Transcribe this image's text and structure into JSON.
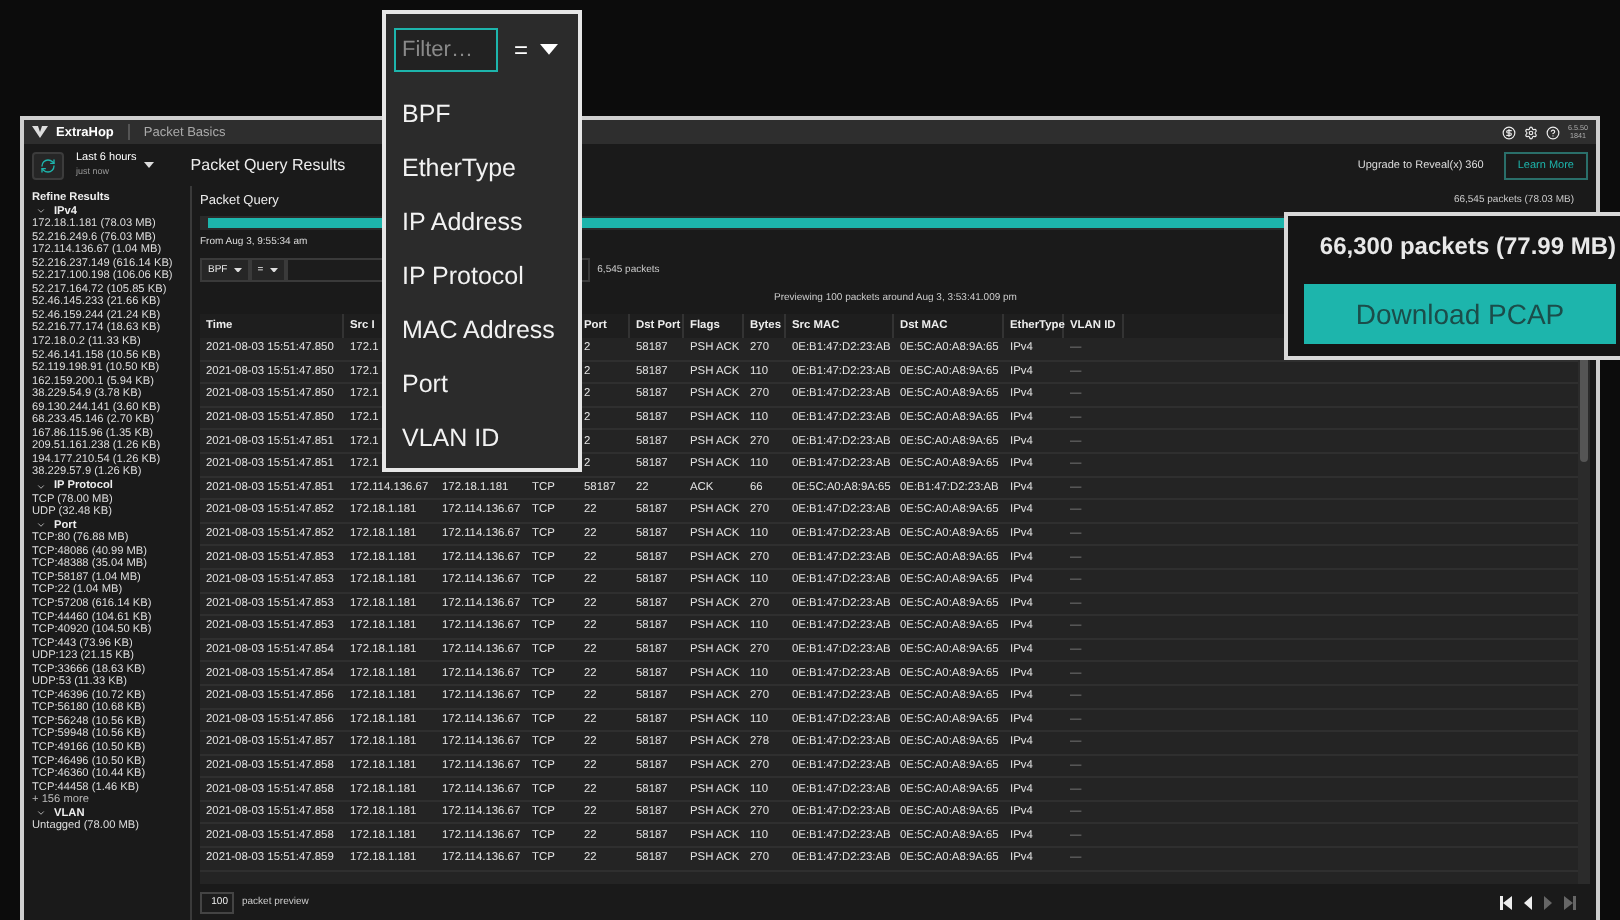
{
  "app": {
    "logo": "ExtraHop",
    "page": "Packet Basics",
    "version": [
      "6.5.50",
      "1841"
    ]
  },
  "toolbar": {
    "time_range": "Last 6 hours",
    "updated": "just now",
    "title": "Packet Query Results",
    "upgrade": "Upgrade to Reveal(x) 360",
    "learn_more": "Learn More"
  },
  "sidebar": {
    "title": "Refine Results",
    "groups": [
      {
        "label": "IPv4",
        "expanded": true,
        "items": [
          "172.18.1.181 (78.03 MB)",
          "52.216.249.6 (76.03 MB)",
          "172.114.136.67 (1.04 MB)",
          "52.216.237.149 (616.14 KB)",
          "52.217.100.198 (106.06 KB)",
          "52.217.164.72 (105.85 KB)",
          "52.46.145.233 (21.66 KB)",
          "52.46.159.244 (21.24 KB)",
          "52.216.77.174 (18.63 KB)",
          "172.18.0.2 (11.33 KB)",
          "52.46.141.158 (10.56 KB)",
          "52.119.198.91 (10.50 KB)",
          "162.159.200.1 (5.94 KB)",
          "38.229.54.9 (3.78 KB)",
          "69.130.244.141 (3.60 KB)",
          "68.233.45.146 (2.70 KB)",
          "167.86.115.96 (1.35 KB)",
          "209.51.161.238 (1.26 KB)",
          "194.177.210.54 (1.26 KB)",
          "38.229.57.9 (1.26 KB)"
        ]
      },
      {
        "label": "IP Protocol",
        "expanded": true,
        "items": [
          "TCP (78.00 MB)",
          "UDP (32.48 KB)"
        ]
      },
      {
        "label": "Port",
        "expanded": true,
        "items": [
          "TCP:80 (76.88 MB)",
          "TCP:48086 (40.99 MB)",
          "TCP:48388 (35.04 MB)",
          "TCP:58187 (1.04 MB)",
          "TCP:22 (1.04 MB)",
          "TCP:57208 (616.14 KB)",
          "TCP:44460 (104.61 KB)",
          "TCP:40920 (104.50 KB)",
          "TCP:443 (73.96 KB)",
          "UDP:123 (21.15 KB)",
          "TCP:33666 (18.63 KB)",
          "UDP:53 (11.33 KB)",
          "TCP:46396 (10.72 KB)",
          "TCP:56180 (10.68 KB)",
          "TCP:56248 (10.56 KB)",
          "TCP:59948 (10.56 KB)",
          "TCP:49166 (10.50 KB)",
          "TCP:46496 (10.50 KB)",
          "TCP:46360 (10.44 KB)",
          "TCP:44458 (1.46 KB)"
        ],
        "more": "+ 156 more"
      },
      {
        "label": "VLAN",
        "expanded": true,
        "items": [
          "Untagged (78.00 MB)"
        ]
      }
    ]
  },
  "query": {
    "title": "Packet Query",
    "total": "66,545 packets (78.03 MB)",
    "range": "From Aug 3, 9:55:34 am",
    "field": "BPF",
    "operator": "=",
    "count": "6,545 packets",
    "preview_note": "Previewing 100 packets around Aug 3, 3:53:41.009 pm"
  },
  "table": {
    "columns": [
      "Time",
      "Src I",
      null,
      null,
      "Port",
      "Dst Port",
      "Flags",
      "Bytes",
      "Src MAC",
      "Dst MAC",
      "EtherType",
      "VLAN ID"
    ],
    "rows": [
      [
        "2021-08-03 15:51:47.850",
        "172.1",
        null,
        null,
        "2",
        "58187",
        "PSH ACK",
        "270",
        "0E:B1:47:D2:23:AB",
        "0E:5C:A0:A8:9A:65",
        "IPv4",
        "—"
      ],
      [
        "2021-08-03 15:51:47.850",
        "172.1",
        null,
        null,
        "2",
        "58187",
        "PSH ACK",
        "110",
        "0E:B1:47:D2:23:AB",
        "0E:5C:A0:A8:9A:65",
        "IPv4",
        "—"
      ],
      [
        "2021-08-03 15:51:47.850",
        "172.1",
        null,
        null,
        "2",
        "58187",
        "PSH ACK",
        "270",
        "0E:B1:47:D2:23:AB",
        "0E:5C:A0:A8:9A:65",
        "IPv4",
        "—"
      ],
      [
        "2021-08-03 15:51:47.850",
        "172.1",
        null,
        null,
        "2",
        "58187",
        "PSH ACK",
        "110",
        "0E:B1:47:D2:23:AB",
        "0E:5C:A0:A8:9A:65",
        "IPv4",
        "—"
      ],
      [
        "2021-08-03 15:51:47.851",
        "172.1",
        null,
        null,
        "2",
        "58187",
        "PSH ACK",
        "270",
        "0E:B1:47:D2:23:AB",
        "0E:5C:A0:A8:9A:65",
        "IPv4",
        "—"
      ],
      [
        "2021-08-03 15:51:47.851",
        "172.1",
        null,
        null,
        "2",
        "58187",
        "PSH ACK",
        "110",
        "0E:B1:47:D2:23:AB",
        "0E:5C:A0:A8:9A:65",
        "IPv4",
        "—"
      ],
      [
        "2021-08-03 15:51:47.851",
        "172.114.136.67",
        "172.18.1.181",
        "TCP",
        "58187",
        "22",
        "ACK",
        "66",
        "0E:5C:A0:A8:9A:65",
        "0E:B1:47:D2:23:AB",
        "IPv4",
        "—"
      ],
      [
        "2021-08-03 15:51:47.852",
        "172.18.1.181",
        "172.114.136.67",
        "TCP",
        "22",
        "58187",
        "PSH ACK",
        "270",
        "0E:B1:47:D2:23:AB",
        "0E:5C:A0:A8:9A:65",
        "IPv4",
        "—"
      ],
      [
        "2021-08-03 15:51:47.852",
        "172.18.1.181",
        "172.114.136.67",
        "TCP",
        "22",
        "58187",
        "PSH ACK",
        "110",
        "0E:B1:47:D2:23:AB",
        "0E:5C:A0:A8:9A:65",
        "IPv4",
        "—"
      ],
      [
        "2021-08-03 15:51:47.853",
        "172.18.1.181",
        "172.114.136.67",
        "TCP",
        "22",
        "58187",
        "PSH ACK",
        "270",
        "0E:B1:47:D2:23:AB",
        "0E:5C:A0:A8:9A:65",
        "IPv4",
        "—"
      ],
      [
        "2021-08-03 15:51:47.853",
        "172.18.1.181",
        "172.114.136.67",
        "TCP",
        "22",
        "58187",
        "PSH ACK",
        "110",
        "0E:B1:47:D2:23:AB",
        "0E:5C:A0:A8:9A:65",
        "IPv4",
        "—"
      ],
      [
        "2021-08-03 15:51:47.853",
        "172.18.1.181",
        "172.114.136.67",
        "TCP",
        "22",
        "58187",
        "PSH ACK",
        "270",
        "0E:B1:47:D2:23:AB",
        "0E:5C:A0:A8:9A:65",
        "IPv4",
        "—"
      ],
      [
        "2021-08-03 15:51:47.853",
        "172.18.1.181",
        "172.114.136.67",
        "TCP",
        "22",
        "58187",
        "PSH ACK",
        "110",
        "0E:B1:47:D2:23:AB",
        "0E:5C:A0:A8:9A:65",
        "IPv4",
        "—"
      ],
      [
        "2021-08-03 15:51:47.854",
        "172.18.1.181",
        "172.114.136.67",
        "TCP",
        "22",
        "58187",
        "PSH ACK",
        "270",
        "0E:B1:47:D2:23:AB",
        "0E:5C:A0:A8:9A:65",
        "IPv4",
        "—"
      ],
      [
        "2021-08-03 15:51:47.854",
        "172.18.1.181",
        "172.114.136.67",
        "TCP",
        "22",
        "58187",
        "PSH ACK",
        "110",
        "0E:B1:47:D2:23:AB",
        "0E:5C:A0:A8:9A:65",
        "IPv4",
        "—"
      ],
      [
        "2021-08-03 15:51:47.856",
        "172.18.1.181",
        "172.114.136.67",
        "TCP",
        "22",
        "58187",
        "PSH ACK",
        "270",
        "0E:B1:47:D2:23:AB",
        "0E:5C:A0:A8:9A:65",
        "IPv4",
        "—"
      ],
      [
        "2021-08-03 15:51:47.856",
        "172.18.1.181",
        "172.114.136.67",
        "TCP",
        "22",
        "58187",
        "PSH ACK",
        "110",
        "0E:B1:47:D2:23:AB",
        "0E:5C:A0:A8:9A:65",
        "IPv4",
        "—"
      ],
      [
        "2021-08-03 15:51:47.857",
        "172.18.1.181",
        "172.114.136.67",
        "TCP",
        "22",
        "58187",
        "PSH ACK",
        "278",
        "0E:B1:47:D2:23:AB",
        "0E:5C:A0:A8:9A:65",
        "IPv4",
        "—"
      ],
      [
        "2021-08-03 15:51:47.858",
        "172.18.1.181",
        "172.114.136.67",
        "TCP",
        "22",
        "58187",
        "PSH ACK",
        "270",
        "0E:B1:47:D2:23:AB",
        "0E:5C:A0:A8:9A:65",
        "IPv4",
        "—"
      ],
      [
        "2021-08-03 15:51:47.858",
        "172.18.1.181",
        "172.114.136.67",
        "TCP",
        "22",
        "58187",
        "PSH ACK",
        "110",
        "0E:B1:47:D2:23:AB",
        "0E:5C:A0:A8:9A:65",
        "IPv4",
        "—"
      ],
      [
        "2021-08-03 15:51:47.858",
        "172.18.1.181",
        "172.114.136.67",
        "TCP",
        "22",
        "58187",
        "PSH ACK",
        "270",
        "0E:B1:47:D2:23:AB",
        "0E:5C:A0:A8:9A:65",
        "IPv4",
        "—"
      ],
      [
        "2021-08-03 15:51:47.858",
        "172.18.1.181",
        "172.114.136.67",
        "TCP",
        "22",
        "58187",
        "PSH ACK",
        "110",
        "0E:B1:47:D2:23:AB",
        "0E:5C:A0:A8:9A:65",
        "IPv4",
        "—"
      ],
      [
        "2021-08-03 15:51:47.859",
        "172.18.1.181",
        "172.114.136.67",
        "TCP",
        "22",
        "58187",
        "PSH ACK",
        "270",
        "0E:B1:47:D2:23:AB",
        "0E:5C:A0:A8:9A:65",
        "IPv4",
        "—"
      ]
    ]
  },
  "footer": {
    "preview_count": "100",
    "preview_label": "packet preview",
    "pager": [
      {
        "kind": "first",
        "disabled": false
      },
      {
        "kind": "prev",
        "disabled": false
      },
      {
        "kind": "next",
        "disabled": true
      },
      {
        "kind": "last",
        "disabled": true
      }
    ]
  },
  "filter_menu": {
    "placeholder": "Filter…",
    "operator": "=",
    "options": [
      "BPF",
      "EtherType",
      "IP Address",
      "IP Protocol",
      "MAC Address",
      "Port",
      "VLAN ID"
    ]
  },
  "download": {
    "summary": "66,300 packets (77.99 MB)",
    "button": "Download PCAP"
  }
}
